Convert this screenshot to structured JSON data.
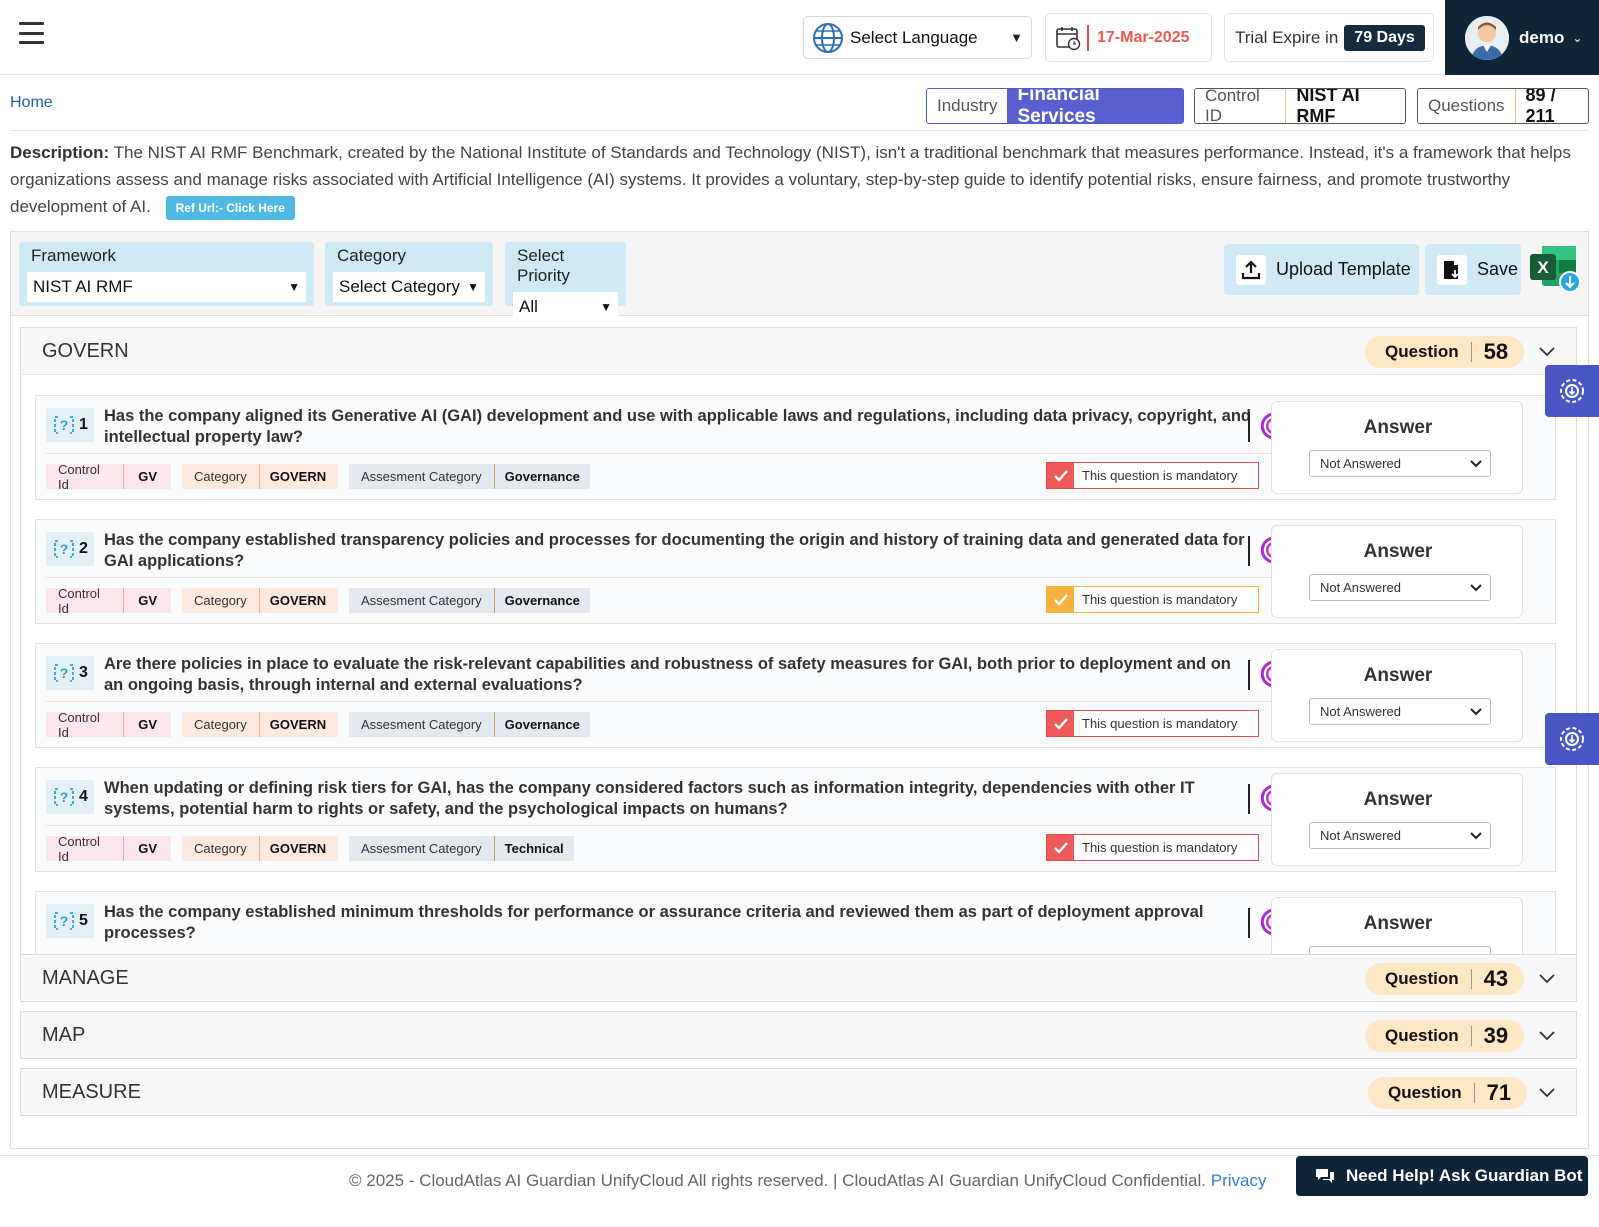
{
  "header": {
    "language_label": "Select Language",
    "date": "17-Mar-2025",
    "trial_label": "Trial Expire in",
    "trial_days": "79  Days",
    "user": "demo"
  },
  "breadcrumb": {
    "home": "Home"
  },
  "pills": {
    "industry_label": "Industry",
    "industry_value": "Financial Services",
    "control_label": "Control ID",
    "control_value": "NIST AI RMF",
    "questions_label": "Questions",
    "questions_value": "89 / 211"
  },
  "description": {
    "label": "Description:",
    "text": "The NIST AI RMF Benchmark, created by the National Institute of Standards and Technology (NIST), isn't a traditional benchmark that measures performance. Instead, it's a framework that helps organizations assess and manage risks associated with Artificial Intelligence (AI) systems. It provides a voluntary, step-by-step guide to identify potential risks, ensure fairness, and promote trustworthy development of AI.",
    "ref_button": "Ref Url:- Click Here"
  },
  "filters": {
    "framework_label": "Framework",
    "framework_value": "NIST AI RMF",
    "category_label": "Category",
    "category_value": "Select Category",
    "priority_label": "Select Priority",
    "priority_value": "All"
  },
  "actions": {
    "upload": "Upload Template",
    "save": "Save"
  },
  "sections": [
    {
      "name": "GOVERN",
      "question_label": "Question",
      "count": "58"
    },
    {
      "name": "MANAGE",
      "question_label": "Question",
      "count": "43"
    },
    {
      "name": "MAP",
      "question_label": "Question",
      "count": "39"
    },
    {
      "name": "MEASURE",
      "question_label": "Question",
      "count": "71"
    }
  ],
  "questions": [
    {
      "num": "1",
      "text": "Has the company aligned its Generative AI (GAI) development and use with applicable laws and regulations, including data privacy, copyright, and intellectual property law?",
      "control_id_label": "Control Id",
      "control_id": "GV",
      "category_label": "Category",
      "category": "GOVERN",
      "assessment_label": "Assesment Category",
      "assessment": "Governance",
      "mandatory": "This question is mandatory",
      "answer_label": "Answer",
      "answer": "Not Answered"
    },
    {
      "num": "2",
      "text": "Has the company established transparency policies and processes for documenting the origin and history of training data and generated data for GAI applications?",
      "control_id_label": "Control Id",
      "control_id": "GV",
      "category_label": "Category",
      "category": "GOVERN",
      "assessment_label": "Assesment Category",
      "assessment": "Governance",
      "mandatory": "This question is mandatory",
      "answer_label": "Answer",
      "answer": "Not Answered"
    },
    {
      "num": "3",
      "text": "Are there policies in place to evaluate the risk-relevant capabilities and robustness of safety measures for GAI, both prior to deployment and on an ongoing basis, through internal and external evaluations?",
      "control_id_label": "Control Id",
      "control_id": "GV",
      "category_label": "Category",
      "category": "GOVERN",
      "assessment_label": "Assesment Category",
      "assessment": "Governance",
      "mandatory": "This question is mandatory",
      "answer_label": "Answer",
      "answer": "Not Answered"
    },
    {
      "num": "4",
      "text": "When updating or defining risk tiers for GAI, has the company considered factors such as information integrity, dependencies with other IT systems, potential harm to rights or safety, and the psychological impacts on humans?",
      "control_id_label": "Control Id",
      "control_id": "GV",
      "category_label": "Category",
      "category": "GOVERN",
      "assessment_label": "Assesment Category",
      "assessment": "Technical",
      "mandatory": "This question is mandatory",
      "answer_label": "Answer",
      "answer": "Not Answered"
    },
    {
      "num": "5",
      "text": "Has the company established minimum thresholds for performance or assurance criteria and reviewed them as part of deployment approval processes?",
      "answer_label": "Answer"
    }
  ],
  "footer": {
    "copyright": "© 2025 - CloudAtlas AI Guardian UnifyCloud All rights reserved. | CloudAtlas AI Guardian UnifyCloud Confidential.",
    "privacy": "Privacy",
    "help": "Need Help! Ask Guardian Bot"
  },
  "colors": {
    "accent": "#5a5fcf",
    "dark_navy": "#0f2436",
    "date_red": "#f0574e",
    "mandatory_red": "#ec5a5a",
    "mandatory_orange": "#f5b23f",
    "filter_blue": "#cfe9f5",
    "question_badge": "#fde7c4"
  },
  "icons": [
    "hamburger-icon",
    "globe-icon",
    "calendar-icon",
    "avatar",
    "upload-icon",
    "save-icon",
    "excel-download-icon",
    "question-icon",
    "guardian-logo-icon",
    "check-icon",
    "chevron-down-icon",
    "gear-icon",
    "chat-icon"
  ]
}
